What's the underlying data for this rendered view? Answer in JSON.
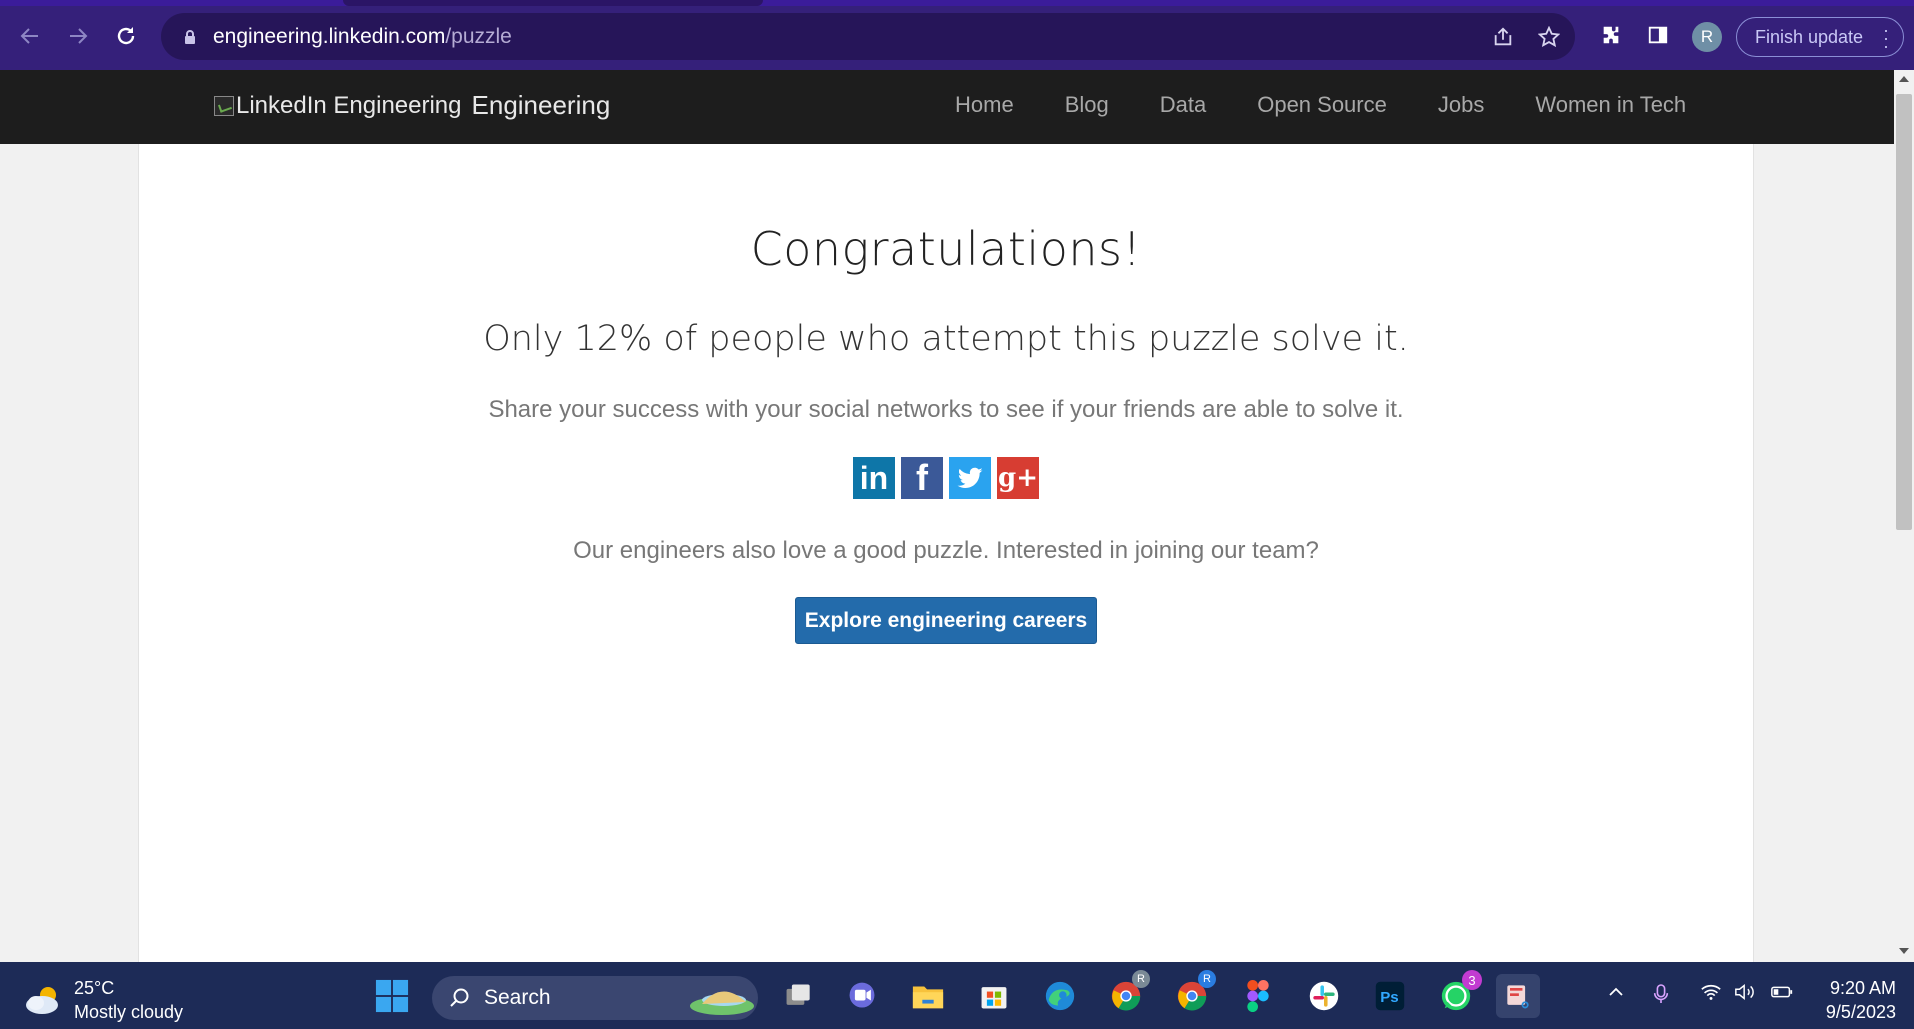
{
  "browser": {
    "url_host": "engineering.linkedin.com",
    "url_path": "/puzzle",
    "profile_initial": "R",
    "finish_update_label": "Finish update"
  },
  "site": {
    "logo_alt": "LinkedIn Engineering",
    "logo_word": "Engineering",
    "nav": [
      "Home",
      "Blog",
      "Data",
      "Open Source",
      "Jobs",
      "Women in Tech"
    ]
  },
  "main": {
    "heading": "Congratulations!",
    "subheading": "Only 12% of people who attempt this puzzle solve it.",
    "share_text": "Share your success with your social networks to see if your friends are able to solve it.",
    "social": {
      "linkedin": "in",
      "facebook": "f",
      "googleplus": "g+"
    },
    "join_text": "Our engineers also love a good puzzle. Interested in joining our team?",
    "careers_button": "Explore engineering careers"
  },
  "taskbar": {
    "temperature": "25°C",
    "weather": "Mostly cloudy",
    "search_label": "Search",
    "whatsapp_badge": "3",
    "chrome_profile_1": "R",
    "chrome_profile_2": "R",
    "time": "9:20 AM",
    "date": "9/5/2023"
  },
  "colors": {
    "chrome_bg": "#35207a",
    "omnibox_bg": "#261559",
    "header_bg": "#1d1d1d",
    "careers_button_bg": "#236bab",
    "taskbar_bg": "#1d2b57"
  }
}
